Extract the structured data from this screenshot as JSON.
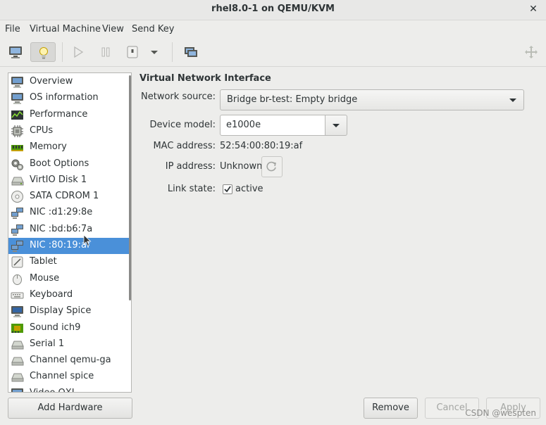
{
  "window": {
    "title": "rhel8.0-1 on QEMU/KVM",
    "close_glyph": "✕"
  },
  "menu": [
    "File",
    "Virtual Machine",
    "View",
    "Send Key"
  ],
  "toolbar_icons": [
    "console-icon",
    "details-bulb-icon",
    "run-icon",
    "pause-icon",
    "shutdown-icon",
    "shutdown-menu-icon",
    "snapshots-icon",
    "fullscreen-icon"
  ],
  "devices": [
    {
      "label": "Overview",
      "icon": "monitor-icon"
    },
    {
      "label": "OS information",
      "icon": "monitor-icon"
    },
    {
      "label": "Performance",
      "icon": "graph-icon"
    },
    {
      "label": "CPUs",
      "icon": "cpu-chip-icon"
    },
    {
      "label": "Memory",
      "icon": "memory-icon"
    },
    {
      "label": "Boot Options",
      "icon": "gears-icon"
    },
    {
      "label": "VirtIO Disk 1",
      "icon": "disk-icon"
    },
    {
      "label": "SATA CDROM 1",
      "icon": "cdrom-icon"
    },
    {
      "label": "NIC :d1:29:8e",
      "icon": "network-icon"
    },
    {
      "label": "NIC :bd:b6:7a",
      "icon": "network-icon"
    },
    {
      "label": "NIC :80:19:af",
      "icon": "network-icon",
      "selected": true
    },
    {
      "label": "Tablet",
      "icon": "tablet-icon"
    },
    {
      "label": "Mouse",
      "icon": "mouse-icon"
    },
    {
      "label": "Keyboard",
      "icon": "keyboard-icon"
    },
    {
      "label": "Display Spice",
      "icon": "display-icon"
    },
    {
      "label": "Sound ich9",
      "icon": "sound-icon"
    },
    {
      "label": "Serial 1",
      "icon": "serial-icon"
    },
    {
      "label": "Channel qemu-ga",
      "icon": "channel-icon"
    },
    {
      "label": "Channel spice",
      "icon": "channel-icon"
    },
    {
      "label": "Video QXL",
      "icon": "video-icon"
    }
  ],
  "buttons": {
    "add_hardware": "Add Hardware",
    "remove": "Remove",
    "cancel": "Cancel",
    "apply": "Apply"
  },
  "nic": {
    "section_title": "Virtual Network Interface",
    "network_source_label": "Network source:",
    "network_source_value": "Bridge br-test: Empty bridge",
    "device_model_label": "Device model:",
    "device_model_value": "e1000e",
    "mac_label": "MAC address:",
    "mac_value": "52:54:00:80:19:af",
    "ip_label": "IP address:",
    "ip_value": "Unknown",
    "link_label": "Link state:",
    "link_value": "active",
    "link_checked": true
  },
  "watermark": "CSDN @wespten",
  "colors": {
    "selection": "#4a90d9",
    "window_bg": "#ededeb"
  }
}
